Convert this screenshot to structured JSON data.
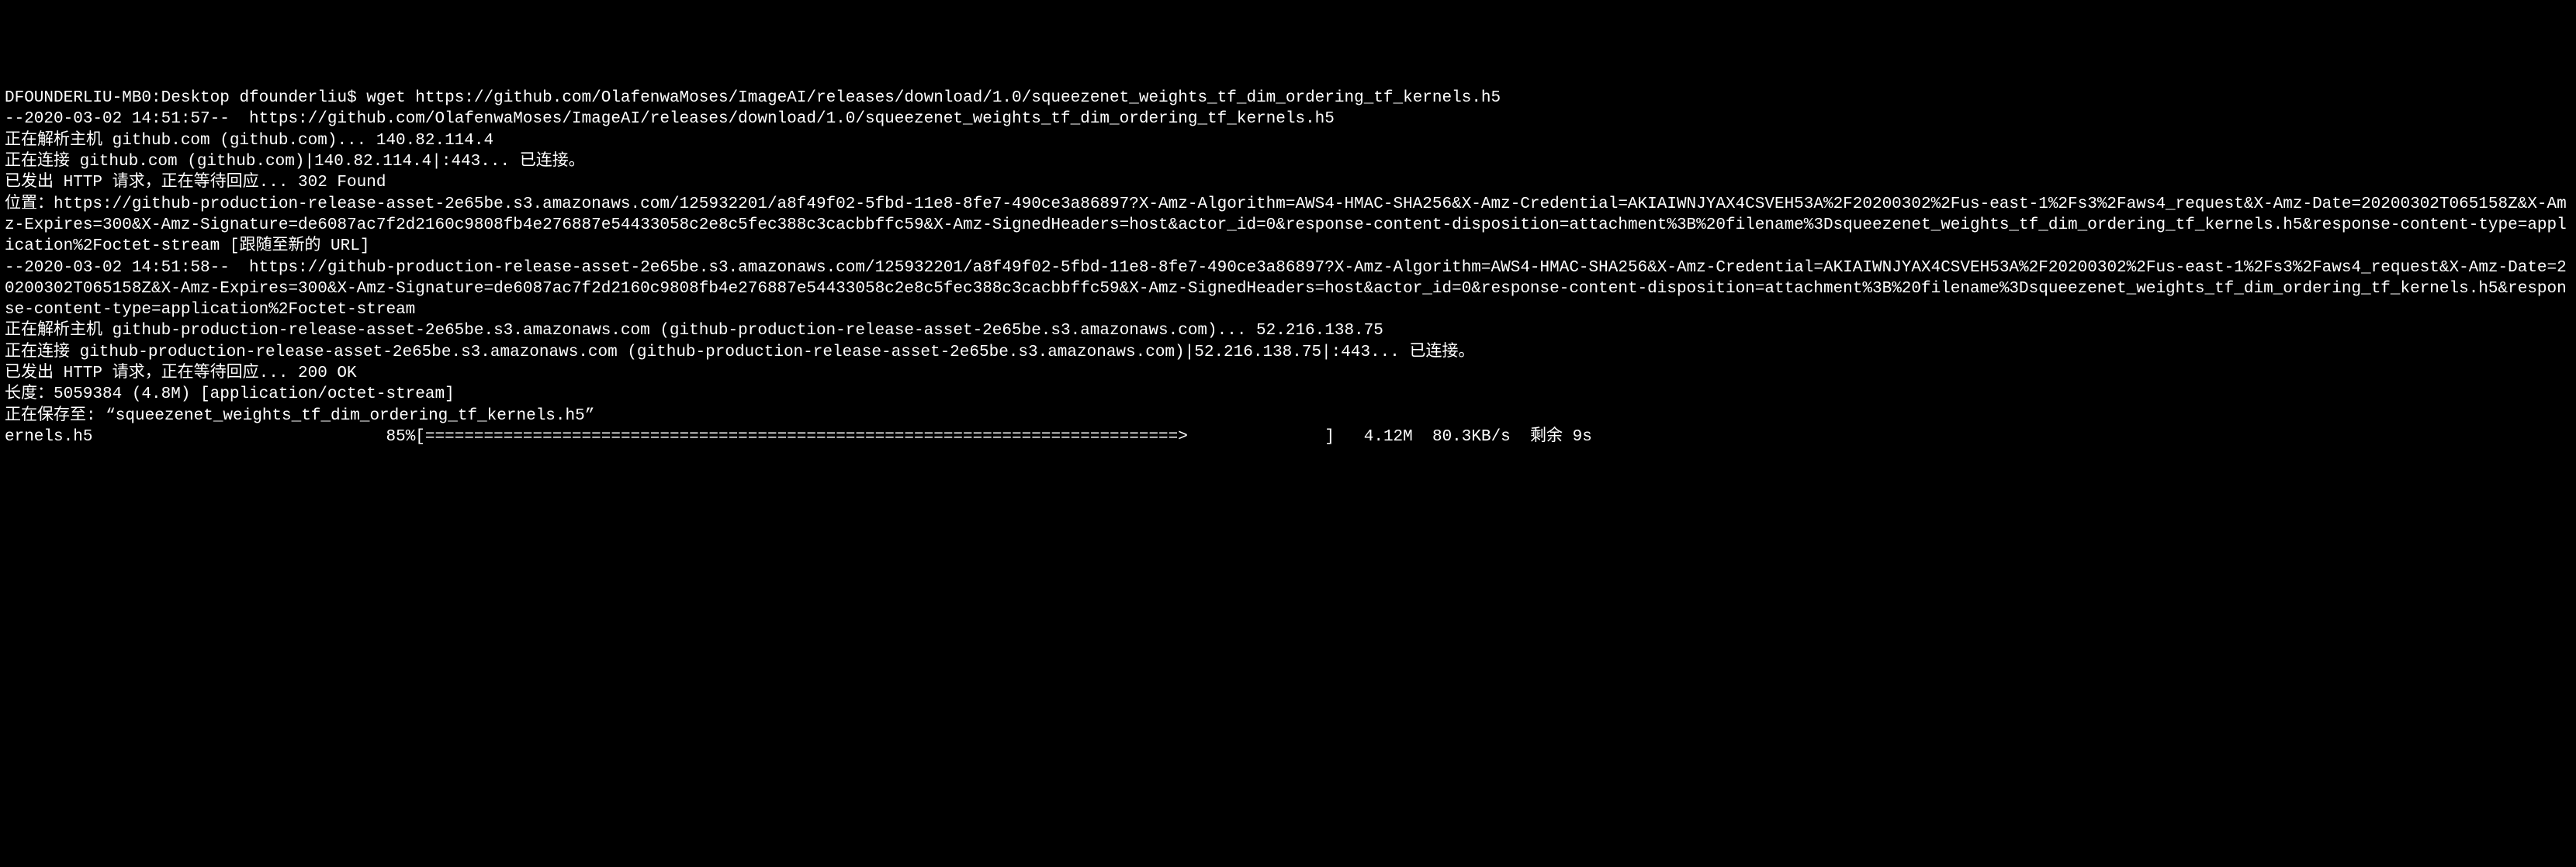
{
  "terminal": {
    "prompt": "DFOUNDERLIU-MB0:Desktop dfounderliu$ ",
    "command": "wget https://github.com/OlafenwaMoses/ImageAI/releases/download/1.0/squeezenet_weights_tf_dim_ordering_tf_kernels.h5",
    "lines": [
      "--2020-03-02 14:51:57--  https://github.com/OlafenwaMoses/ImageAI/releases/download/1.0/squeezenet_weights_tf_dim_ordering_tf_kernels.h5",
      "正在解析主机 github.com (github.com)... 140.82.114.4",
      "正在连接 github.com (github.com)|140.82.114.4|:443... 已连接。",
      "已发出 HTTP 请求，正在等待回应... 302 Found",
      "位置：https://github-production-release-asset-2e65be.s3.amazonaws.com/125932201/a8f49f02-5fbd-11e8-8fe7-490ce3a86897?X-Amz-Algorithm=AWS4-HMAC-SHA256&X-Amz-Credential=AKIAIWNJYAX4CSVEH53A%2F20200302%2Fus-east-1%2Fs3%2Faws4_request&X-Amz-Date=20200302T065158Z&X-Amz-Expires=300&X-Amz-Signature=de6087ac7f2d2160c9808fb4e276887e54433058c2e8c5fec388c3cacbbffc59&X-Amz-SignedHeaders=host&actor_id=0&response-content-disposition=attachment%3B%20filename%3Dsqueezenet_weights_tf_dim_ordering_tf_kernels.h5&response-content-type=application%2Foctet-stream [跟随至新的 URL]",
      "--2020-03-02 14:51:58--  https://github-production-release-asset-2e65be.s3.amazonaws.com/125932201/a8f49f02-5fbd-11e8-8fe7-490ce3a86897?X-Amz-Algorithm=AWS4-HMAC-SHA256&X-Amz-Credential=AKIAIWNJYAX4CSVEH53A%2F20200302%2Fus-east-1%2Fs3%2Faws4_request&X-Amz-Date=20200302T065158Z&X-Amz-Expires=300&X-Amz-Signature=de6087ac7f2d2160c9808fb4e276887e54433058c2e8c5fec388c3cacbbffc59&X-Amz-SignedHeaders=host&actor_id=0&response-content-disposition=attachment%3B%20filename%3Dsqueezenet_weights_tf_dim_ordering_tf_kernels.h5&response-content-type=application%2Foctet-stream",
      "正在解析主机 github-production-release-asset-2e65be.s3.amazonaws.com (github-production-release-asset-2e65be.s3.amazonaws.com)... 52.216.138.75",
      "正在连接 github-production-release-asset-2e65be.s3.amazonaws.com (github-production-release-asset-2e65be.s3.amazonaws.com)|52.216.138.75|:443... 已连接。",
      "已发出 HTTP 请求，正在等待回应... 200 OK",
      "长度：5059384 (4.8M) [application/octet-stream]",
      "正在保存至: “squeezenet_weights_tf_dim_ordering_tf_kernels.h5”",
      ""
    ],
    "progress": {
      "filename": "ernels.h5",
      "percent": "85%",
      "bar_open": "[",
      "bar_fill": "=============================================================================>",
      "bar_empty": "              ",
      "bar_close": "]",
      "downloaded": "4.12M",
      "speed": "80.3KB/s",
      "eta_label": "剩余",
      "eta": "9s"
    }
  }
}
